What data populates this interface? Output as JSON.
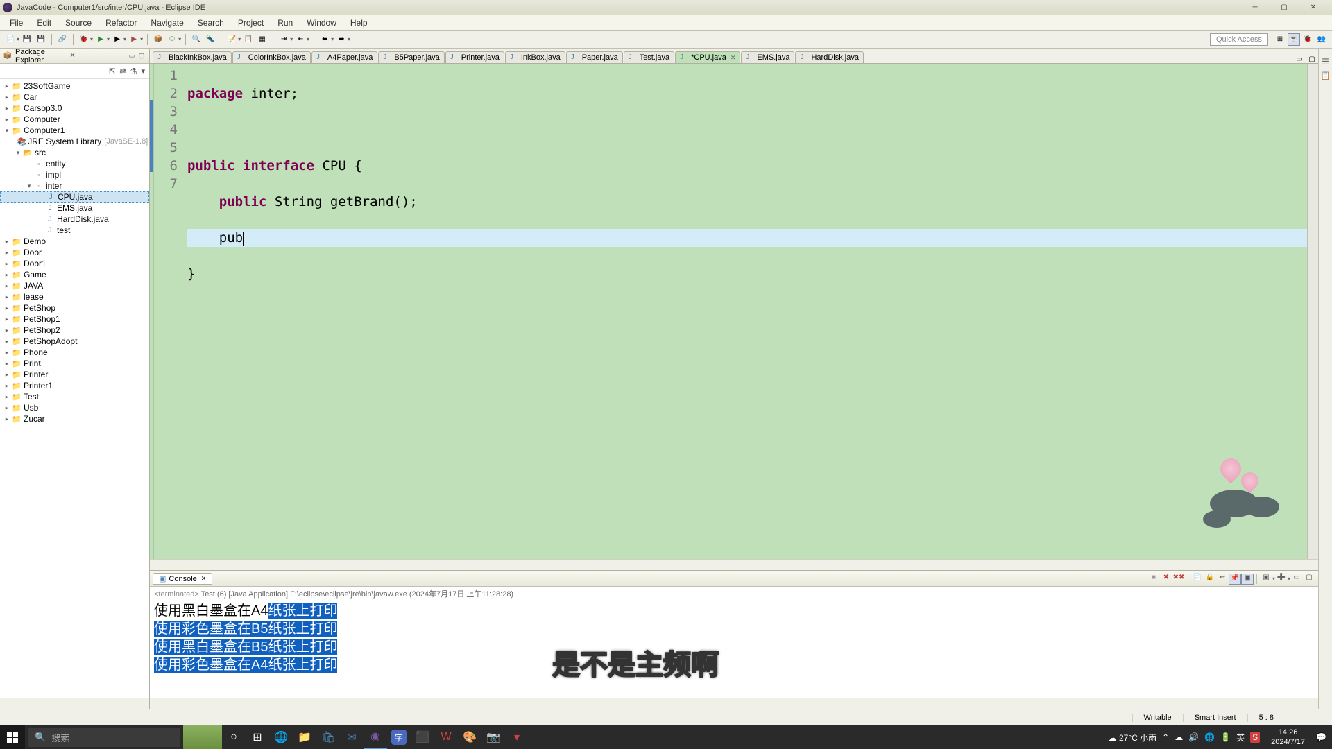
{
  "window": {
    "title": "JavaCode - Computer1/src/inter/CPU.java - Eclipse IDE"
  },
  "menu": [
    "File",
    "Edit",
    "Source",
    "Refactor",
    "Navigate",
    "Search",
    "Project",
    "Run",
    "Window",
    "Help"
  ],
  "quick_access": "Quick Access",
  "package_explorer": {
    "title": "Package Explorer",
    "projects": [
      {
        "name": "23SoftGame",
        "open": false
      },
      {
        "name": "Car",
        "open": false
      },
      {
        "name": "Carsop3.0",
        "open": false
      },
      {
        "name": "Computer",
        "open": false
      },
      {
        "name": "Computer1",
        "open": true,
        "children": [
          {
            "type": "jre",
            "name": "JRE System Library",
            "deco": "[JavaSE-1.8]"
          },
          {
            "type": "srcfolder",
            "name": "src",
            "open": true,
            "children": [
              {
                "type": "pkg",
                "name": "entity"
              },
              {
                "type": "pkg",
                "name": "impl"
              },
              {
                "type": "pkg",
                "name": "inter",
                "open": true,
                "children": [
                  {
                    "type": "java",
                    "name": "CPU.java",
                    "selected": true
                  },
                  {
                    "type": "java",
                    "name": "EMS.java"
                  },
                  {
                    "type": "java",
                    "name": "HardDisk.java"
                  },
                  {
                    "type": "java",
                    "name": "test"
                  }
                ]
              }
            ]
          }
        ]
      },
      {
        "name": "Demo"
      },
      {
        "name": "Door"
      },
      {
        "name": "Door1"
      },
      {
        "name": "Game"
      },
      {
        "name": "JAVA"
      },
      {
        "name": "lease"
      },
      {
        "name": "PetShop"
      },
      {
        "name": "PetShop1"
      },
      {
        "name": "PetShop2"
      },
      {
        "name": "PetShopAdopt"
      },
      {
        "name": "Phone"
      },
      {
        "name": "Print"
      },
      {
        "name": "Printer"
      },
      {
        "name": "Printer1"
      },
      {
        "name": "Test"
      },
      {
        "name": "Usb"
      },
      {
        "name": "Zucar"
      }
    ]
  },
  "editor": {
    "tabs": [
      {
        "label": "BlackInkBox.java"
      },
      {
        "label": "ColorInkBox.java"
      },
      {
        "label": "A4Paper.java"
      },
      {
        "label": "B5Paper.java"
      },
      {
        "label": "Printer.java"
      },
      {
        "label": "InkBox.java"
      },
      {
        "label": "Paper.java"
      },
      {
        "label": "Test.java"
      },
      {
        "label": "*CPU.java",
        "active": true
      },
      {
        "label": "EMS.java"
      },
      {
        "label": "HardDisk.java"
      }
    ],
    "code": {
      "line1_kw": "package",
      "line1_rest": " inter;",
      "line3_kw1": "public",
      "line3_kw2": "interface",
      "line3_rest": " CPU {",
      "line4_kw": "public",
      "line4_rest": " String getBrand();",
      "line5_partial": "pub",
      "line6": "}"
    },
    "line_numbers": [
      "1",
      "2",
      "3",
      "4",
      "5",
      "6",
      "7"
    ]
  },
  "console": {
    "tab": "Console",
    "info_prefix": "<terminated>",
    "info": "Test (6) [Java Application] F:\\eclipse\\eclipse\\jre\\bin\\javaw.exe (2024年7月17日 上午11:28:28)",
    "lines": [
      {
        "pre": "使用黑白墨盒在A4",
        "sel": "纸张上打印"
      },
      {
        "pre": "",
        "sel": "使用彩色墨盒在B5纸张上打印"
      },
      {
        "pre": "",
        "sel": "使用黑白墨盒在B5纸张上打印"
      },
      {
        "pre": "",
        "sel": "使用彩色墨盒在A4纸张上打印"
      }
    ]
  },
  "statusbar": {
    "writable": "Writable",
    "insert": "Smart Insert",
    "pos": "5 : 8"
  },
  "taskbar": {
    "search_placeholder": "搜索",
    "weather": "27°C  小雨",
    "ime": "英",
    "clock_time": "14:26",
    "clock_date": "2024/7/17"
  },
  "subtitle": "是不是主频啊"
}
